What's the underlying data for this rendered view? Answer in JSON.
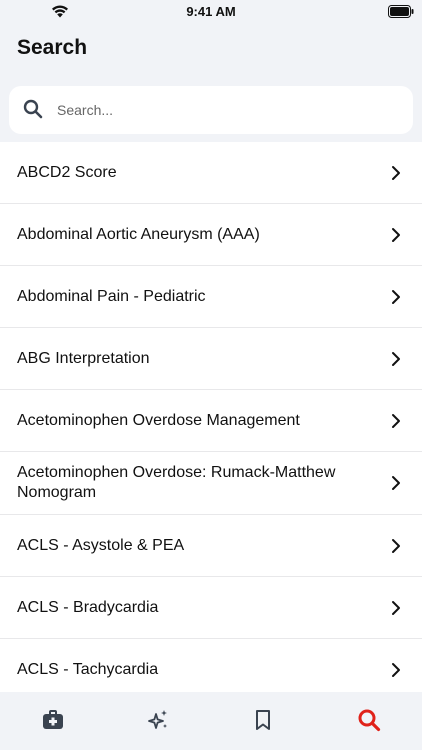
{
  "status_bar": {
    "time": "9:41 AM"
  },
  "header": {
    "title": "Search"
  },
  "search": {
    "placeholder": "Search...",
    "value": ""
  },
  "list": {
    "items": [
      {
        "label": "ABCD2 Score"
      },
      {
        "label": "Abdominal Aortic Aneurysm (AAA)"
      },
      {
        "label": "Abdominal Pain - Pediatric"
      },
      {
        "label": "ABG Interpretation"
      },
      {
        "label": "Acetominophen Overdose Management"
      },
      {
        "label": "Acetominophen Overdose: Rumack-Matthew Nomogram"
      },
      {
        "label": "ACLS - Asystole & PEA"
      },
      {
        "label": "ACLS - Bradycardia"
      },
      {
        "label": "ACLS - Tachycardia"
      }
    ]
  },
  "tab_bar": {
    "tabs": [
      {
        "icon": "medical-kit-icon",
        "active": false
      },
      {
        "icon": "sparkles-icon",
        "active": false
      },
      {
        "icon": "bookmark-icon",
        "active": false
      },
      {
        "icon": "search-icon",
        "active": true
      }
    ]
  },
  "colors": {
    "accent": "#e0221a",
    "icon_gray": "#3a4350"
  }
}
